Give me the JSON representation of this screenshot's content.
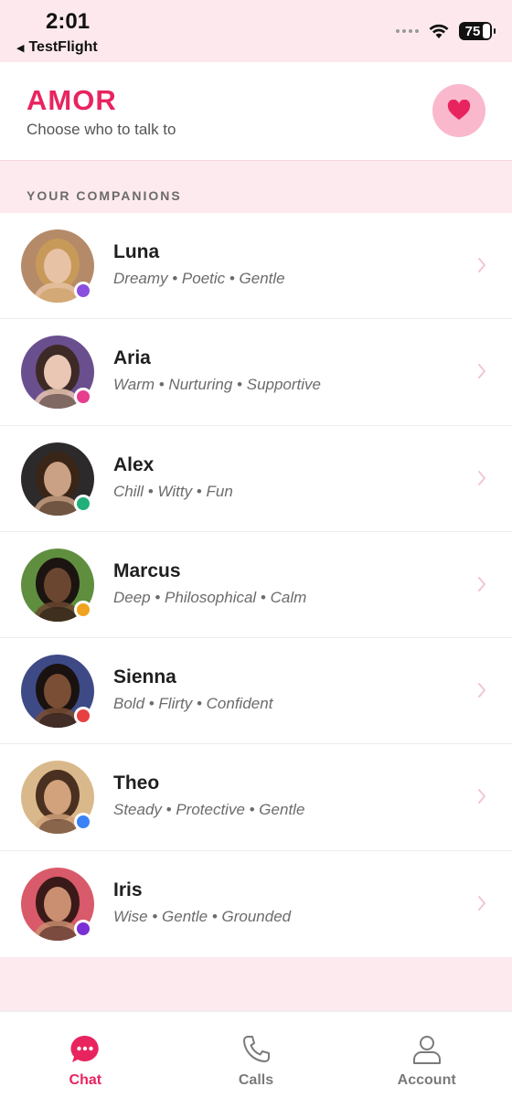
{
  "status_bar": {
    "time": "2:01",
    "back_app": "TestFlight",
    "battery": "75"
  },
  "header": {
    "title": "AMOR",
    "subtitle": "Choose who to talk to",
    "heart_button_icon": "heart-icon"
  },
  "section": {
    "label": "YOUR COMPANIONS"
  },
  "companions": [
    {
      "name": "Luna",
      "traits": "Dreamy • Poetic • Gentle",
      "status_color": "#8b4fe0",
      "avatar_bg": "#b58a68",
      "avatar_hair": "#c79a5a",
      "avatar_skin": "#e8c2a5"
    },
    {
      "name": "Aria",
      "traits": "Warm • Nurturing • Supportive",
      "status_color": "#e83c8f",
      "avatar_bg": "#6a4f8f",
      "avatar_hair": "#3d2a26",
      "avatar_skin": "#e9c7b4"
    },
    {
      "name": "Alex",
      "traits": "Chill • Witty • Fun",
      "status_color": "#22b07a",
      "avatar_bg": "#2c2a2a",
      "avatar_hair": "#3a2618",
      "avatar_skin": "#caa184"
    },
    {
      "name": "Marcus",
      "traits": "Deep • Philosophical • Calm",
      "status_color": "#f0a31e",
      "avatar_bg": "#5f8f3e",
      "avatar_hair": "#1c1410",
      "avatar_skin": "#6a4630"
    },
    {
      "name": "Sienna",
      "traits": "Bold • Flirty • Confident",
      "status_color": "#e84040",
      "avatar_bg": "#3e4a86",
      "avatar_hair": "#1a1210",
      "avatar_skin": "#7a4e34"
    },
    {
      "name": "Theo",
      "traits": "Steady • Protective • Gentle",
      "status_color": "#3b82f6",
      "avatar_bg": "#d9b98b",
      "avatar_hair": "#4a3020",
      "avatar_skin": "#d1a27c"
    },
    {
      "name": "Iris",
      "traits": "Wise • Gentle • Grounded",
      "status_color": "#7b2fd6",
      "avatar_bg": "#d95a6a",
      "avatar_hair": "#3a1a18",
      "avatar_skin": "#c98f70"
    }
  ],
  "tabs": [
    {
      "label": "Chat",
      "icon": "chat-bubble-icon",
      "active": true
    },
    {
      "label": "Calls",
      "icon": "phone-icon",
      "active": false
    },
    {
      "label": "Account",
      "icon": "person-icon",
      "active": false
    }
  ],
  "colors": {
    "accent": "#e8245f",
    "accent_soft": "#f9b8cc",
    "background": "#fdeaee"
  }
}
